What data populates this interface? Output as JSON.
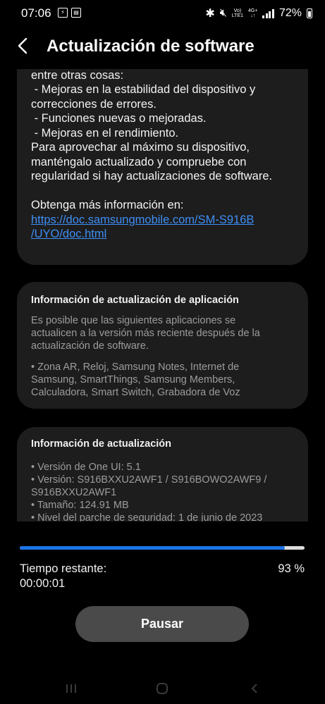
{
  "status_bar": {
    "time": "07:06",
    "battery": "72%",
    "lte_top": "Vo)",
    "lte_bottom": "LTE1",
    "net_top": "4G+",
    "net_bottom": "↓↑"
  },
  "header": {
    "title": "Actualización de software"
  },
  "changelog": {
    "lines": [
      "entre otras cosas:",
      " - Mejoras en la estabilidad del dispositivo y",
      "correcciones de errores.",
      " - Funciones nuevas o mejoradas.",
      " - Mejoras en el rendimiento.",
      "Para aprovechar al máximo su dispositivo,",
      "manténgalo actualizado y compruebe con",
      "regularidad si hay actualizaciones de software."
    ],
    "more_info": "Obtenga más información en:",
    "link_line1": "https://doc.samsungmobile.com/SM-S916B",
    "link_line2": "/UYO/doc.html"
  },
  "app_update": {
    "title": "Información de actualización de aplicación",
    "desc": [
      "Es posible que las siguientes aplicaciones se",
      "actualicen a la versión más reciente después de la",
      "actualización de software."
    ],
    "apps": [
      "• Zona AR, Reloj, Samsung Notes, Internet de",
      "Samsung, SmartThings, Samsung Members,",
      "Calculadora, Smart Switch, Grabadora de Voz"
    ]
  },
  "update_info": {
    "title": "Información de actualización",
    "lines": [
      "• Versión de One UI: 5.1",
      "• Versión: S916BXXU2AWF1 / S916BOWO2AWF9 /",
      "S916BXXU2AWF1",
      "• Tamaño: 124.91 MB",
      "• Nivel del parche de seguridad: 1 de junio de 2023"
    ]
  },
  "progress": {
    "fraction": 0.93,
    "remaining_label": "Tiempo restante:",
    "remaining_time": "00:00:01",
    "percent": "93 %"
  },
  "pause_label": "Pausar",
  "colors": {
    "accent": "#1c74e8",
    "link": "#3e8ef5",
    "card_bg": "#1d1d1d",
    "button_bg": "#4a4a4a"
  }
}
